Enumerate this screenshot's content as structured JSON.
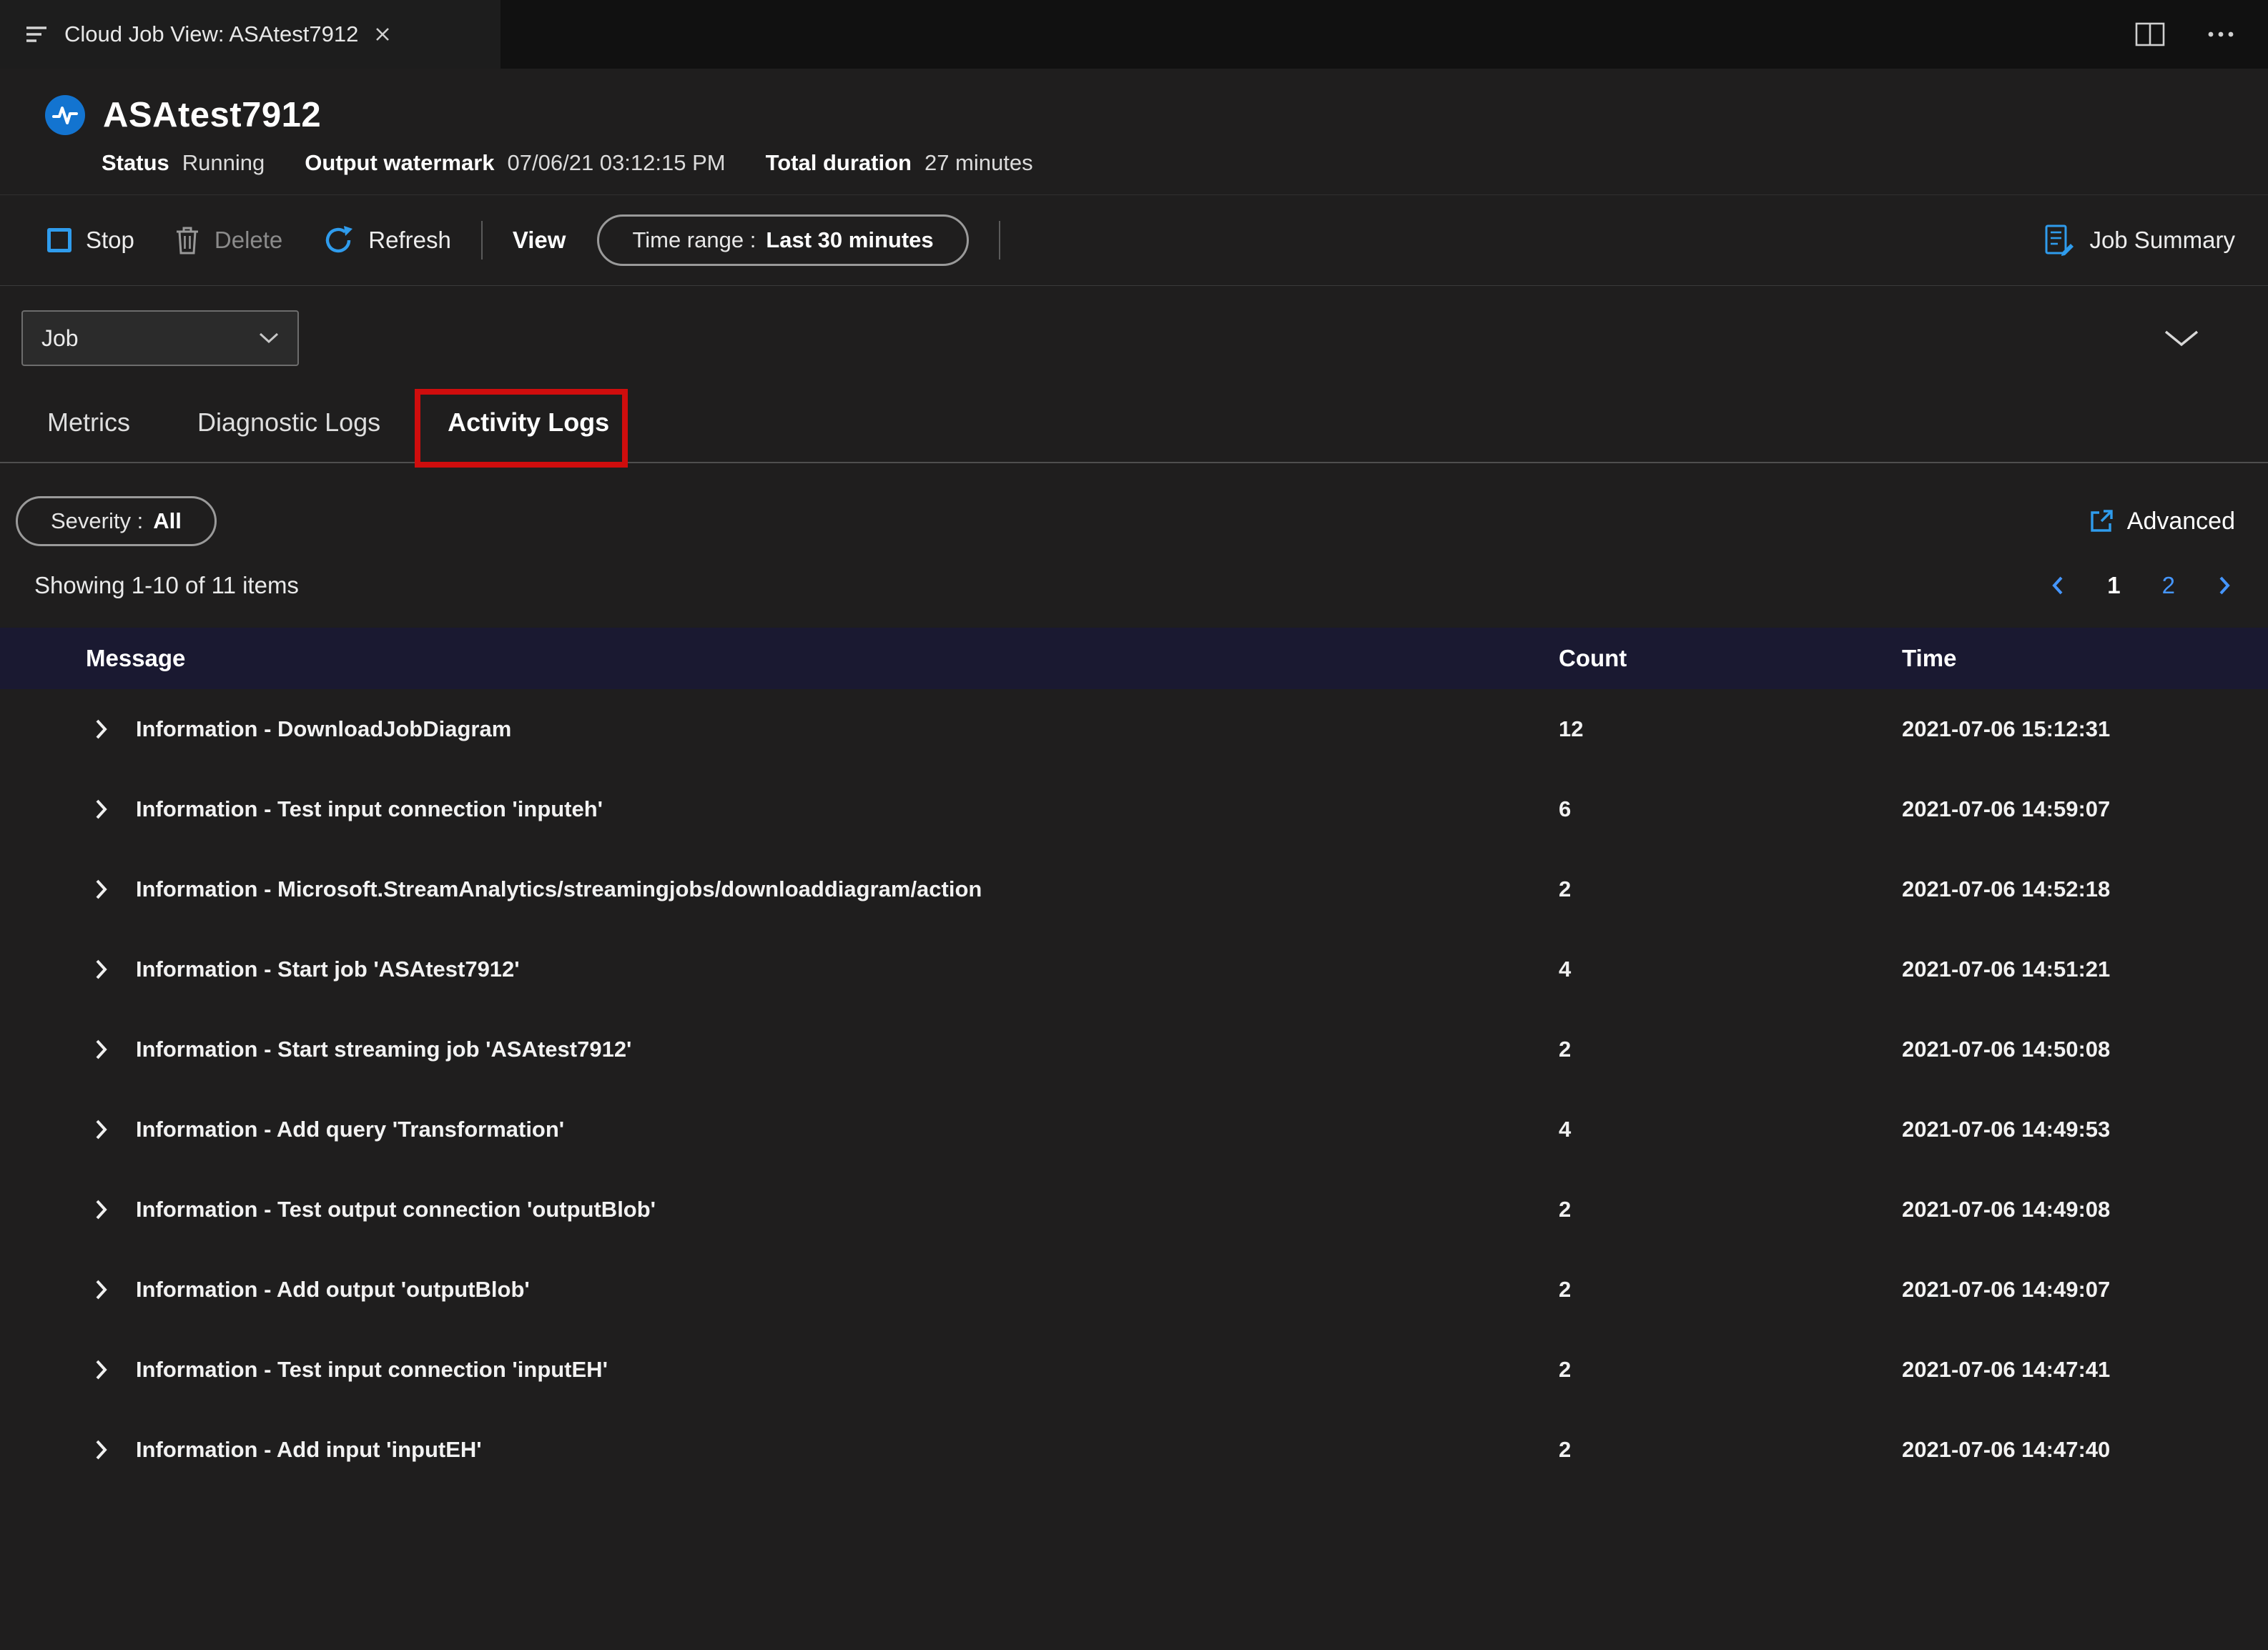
{
  "tab_bar": {
    "tab_title": "Cloud Job View: ASAtest7912"
  },
  "header": {
    "title": "ASAtest7912",
    "status_label": "Status",
    "status_value": "Running",
    "watermark_label": "Output watermark",
    "watermark_value": "07/06/21 03:12:15 PM",
    "duration_label": "Total duration",
    "duration_value": "27 minutes"
  },
  "toolbar": {
    "stop": "Stop",
    "delete": "Delete",
    "refresh": "Refresh",
    "view": "View",
    "time_range_label": "Time range :",
    "time_range_value": "Last 30 minutes",
    "job_summary": "Job Summary"
  },
  "filters": {
    "job_dropdown": "Job",
    "severity_label": "Severity :",
    "severity_value": "All",
    "advanced": "Advanced"
  },
  "tabs": [
    {
      "label": "Metrics",
      "active": false
    },
    {
      "label": "Diagnostic Logs",
      "active": false
    },
    {
      "label": "Activity Logs",
      "active": true
    }
  ],
  "list": {
    "showing": "Showing 1-10 of 11 items",
    "pages": [
      "1",
      "2"
    ],
    "current_page": "1"
  },
  "table": {
    "columns": [
      "Message",
      "Count",
      "Time"
    ],
    "rows": [
      {
        "message": "Information - DownloadJobDiagram",
        "count": "12",
        "time": "2021-07-06 15:12:31"
      },
      {
        "message": "Information - Test input connection 'inputeh'",
        "count": "6",
        "time": "2021-07-06 14:59:07"
      },
      {
        "message": "Information - Microsoft.StreamAnalytics/streamingjobs/downloaddiagram/action",
        "count": "2",
        "time": "2021-07-06 14:52:18"
      },
      {
        "message": "Information - Start job 'ASAtest7912'",
        "count": "4",
        "time": "2021-07-06 14:51:21"
      },
      {
        "message": "Information - Start streaming job 'ASAtest7912'",
        "count": "2",
        "time": "2021-07-06 14:50:08"
      },
      {
        "message": "Information - Add query 'Transformation'",
        "count": "4",
        "time": "2021-07-06 14:49:53"
      },
      {
        "message": "Information - Test output connection 'outputBlob'",
        "count": "2",
        "time": "2021-07-06 14:49:08"
      },
      {
        "message": "Information - Add output 'outputBlob'",
        "count": "2",
        "time": "2021-07-06 14:49:07"
      },
      {
        "message": "Information - Test input connection 'inputEH'",
        "count": "2",
        "time": "2021-07-06 14:47:41"
      },
      {
        "message": "Information - Add input 'inputEH'",
        "count": "2",
        "time": "2021-07-06 14:47:40"
      }
    ]
  },
  "colors": {
    "accent_blue": "#2f9ced",
    "link_blue": "#4596ff",
    "annotation_red": "#cf0d0d",
    "table_header_navy": "#1a1931",
    "background": "#1f1e1e"
  }
}
